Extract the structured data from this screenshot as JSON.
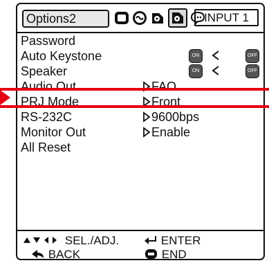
{
  "header": {
    "title": "Options2",
    "input_label": "INPUT 1",
    "tabs": [
      {
        "icon": "picture-tab-icon"
      },
      {
        "icon": "sound-tab-icon"
      },
      {
        "icon": "options1-tab-icon"
      },
      {
        "icon": "options2-tab-icon",
        "selected": true
      },
      {
        "icon": "language-tab-icon"
      }
    ]
  },
  "menu": {
    "items": [
      {
        "label": "Password",
        "value": ""
      },
      {
        "label": "Auto Keystone",
        "value": ""
      },
      {
        "label": "Speaker",
        "value": ""
      },
      {
        "label": "Audio Out",
        "value": "FAO"
      },
      {
        "label": "PRJ Mode",
        "value": "Front"
      },
      {
        "label": "RS-232C",
        "value": "9600bps"
      },
      {
        "label": "Monitor Out",
        "value": "Enable"
      },
      {
        "label": "All Reset",
        "value": ""
      }
    ],
    "toggle_left": "ON",
    "toggle_right": "OFF"
  },
  "footer": {
    "sel_adj": "SEL./ADJ.",
    "enter": "ENTER",
    "back": "BACK",
    "end": "END"
  },
  "colors": {
    "highlight": "#e60012",
    "selected_tab": "#d9d9d9"
  }
}
